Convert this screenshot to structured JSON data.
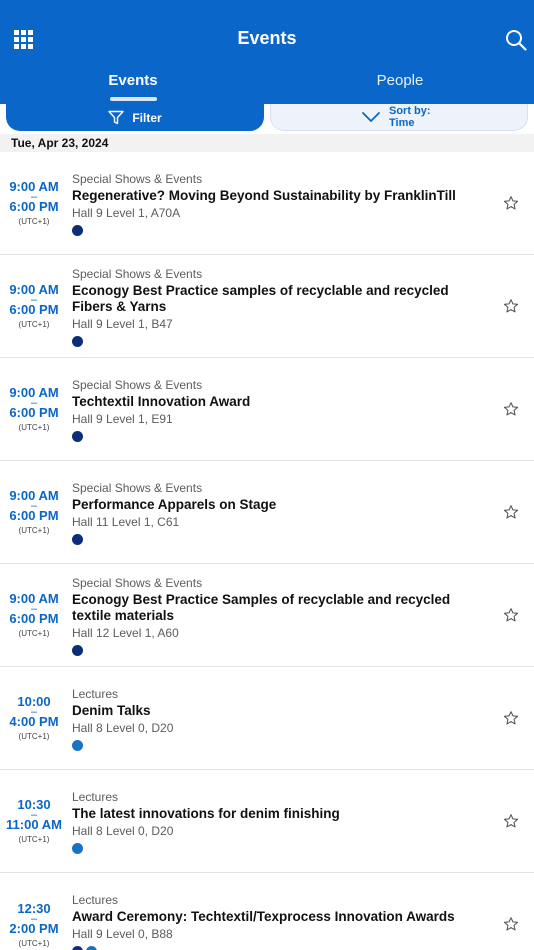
{
  "header": {
    "title": "Events",
    "menu_icon": "grid-menu-icon",
    "search_icon": "search-icon",
    "background": "#0a67c9"
  },
  "tabs": [
    {
      "label": "Events",
      "selected": true
    },
    {
      "label": "People",
      "selected": false
    }
  ],
  "toolbar": {
    "filter_label": "Filter",
    "sort_label_1": "Sort by:",
    "sort_label_2": "Time"
  },
  "date_label": "Tue, Apr 23, 2024",
  "colors": {
    "accent": "#0a67c9",
    "dot_special": "#0b2e78",
    "dot_lecture": "#1a72c3"
  },
  "events": [
    {
      "start": "9:00 AM",
      "end": "6:00 PM",
      "tz": "(UTC+1)",
      "category": "Special Shows & Events",
      "title": "Regenerative? Moving Beyond Sustainability by FranklinTill",
      "location": "Hall 9 Level 1, A70A",
      "dots": [
        "#0b2e78"
      ],
      "favorite": false
    },
    {
      "start": "9:00 AM",
      "end": "6:00 PM",
      "tz": "(UTC+1)",
      "category": "Special Shows & Events",
      "title": "Econogy Best Practice samples of recyclable and recycled Fibers & Yarns",
      "location": "Hall 9 Level 1, B47",
      "dots": [
        "#0b2e78"
      ],
      "favorite": false
    },
    {
      "start": "9:00 AM",
      "end": "6:00 PM",
      "tz": "(UTC+1)",
      "category": "Special Shows & Events",
      "title": "Techtextil Innovation Award",
      "location": "Hall 9 Level 1, E91",
      "dots": [
        "#0b2e78"
      ],
      "favorite": false
    },
    {
      "start": "9:00 AM",
      "end": "6:00 PM",
      "tz": "(UTC+1)",
      "category": "Special Shows & Events",
      "title": "Performance Apparels on Stage",
      "location": "Hall 11 Level 1, C61",
      "dots": [
        "#0b2e78"
      ],
      "favorite": false
    },
    {
      "start": "9:00 AM",
      "end": "6:00 PM",
      "tz": "(UTC+1)",
      "category": "Special Shows & Events",
      "title": "Econogy Best Practice Samples of recyclable and recycled textile materials",
      "location": "Hall 12 Level 1, A60",
      "dots": [
        "#0b2e78"
      ],
      "favorite": false
    },
    {
      "start": "10:00",
      "end": "4:00 PM",
      "tz": "(UTC+1)",
      "category": "Lectures",
      "title": "Denim Talks",
      "location": "Hall 8 Level 0, D20",
      "dots": [
        "#1a72c3"
      ],
      "favorite": false
    },
    {
      "start": "10:30",
      "end": "11:00 AM",
      "tz": "(UTC+1)",
      "category": "Lectures",
      "title": "The latest innovations for denim finishing",
      "location": "Hall 8 Level 0, D20",
      "dots": [
        "#1a72c3"
      ],
      "favorite": false
    },
    {
      "start": "12:30",
      "end": "2:00 PM",
      "tz": "(UTC+1)",
      "category": "Lectures",
      "title": "Award Ceremony: Techtextil/Texprocess Innovation Awards",
      "location": "Hall 9 Level 0, B88",
      "dots": [
        "#0b2e78",
        "#1a72c3"
      ],
      "favorite": false
    }
  ]
}
